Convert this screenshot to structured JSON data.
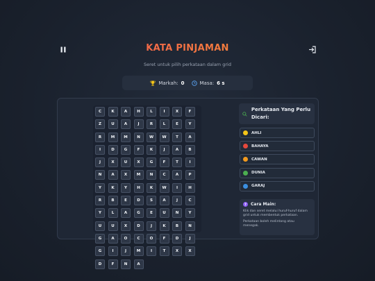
{
  "header": {
    "title": "KATA PINJAMAN",
    "subtitle": "Seret untuk pilih perkataan dalam grid",
    "pause_icon": "pause-icon",
    "exit_icon": "exit-icon"
  },
  "stats": {
    "score_label": "Markah:",
    "score_value": "0",
    "time_label": "Masa:",
    "time_value": "6 s"
  },
  "grid": [
    [
      "C",
      "K",
      "A",
      "H",
      "L",
      "I",
      "X",
      "F",
      "Z",
      "U"
    ],
    [
      "A",
      "J",
      "R",
      "L",
      "E",
      "Y",
      "R",
      "M",
      "M",
      "N"
    ],
    [
      "W",
      "W",
      "T",
      "A",
      "I",
      "D",
      "G",
      "F",
      "K",
      "J"
    ],
    [
      "A",
      "B",
      "J",
      "X",
      "U",
      "X",
      "G",
      "F",
      "T",
      "I"
    ],
    [
      "N",
      "A",
      "X",
      "M",
      "N",
      "C",
      "A",
      "P",
      "Y",
      "K"
    ],
    [
      "Y",
      "H",
      "K",
      "W",
      "I",
      "H",
      "R",
      "B",
      "E",
      "D"
    ],
    [
      "S",
      "A",
      "J",
      "C",
      "Y",
      "L",
      "A",
      "G",
      "E",
      "U"
    ],
    [
      "N",
      "Y",
      "U",
      "U",
      "X",
      "D",
      "J",
      "K",
      "B",
      "N"
    ],
    [
      "G",
      "A",
      "O",
      "C",
      "O",
      "F",
      "D",
      "J",
      "G",
      "I"
    ],
    [
      "J",
      "M",
      "I",
      "T",
      "X",
      "X",
      "D",
      "F",
      "N",
      "A"
    ]
  ],
  "words_panel": {
    "title": "Perkataan Yang Perlu Dicari:",
    "words": [
      {
        "label": "AHLI",
        "color": "#f5c518"
      },
      {
        "label": "BAHAYA",
        "color": "#e5483c"
      },
      {
        "label": "CAWAN",
        "color": "#f39a1e"
      },
      {
        "label": "DUNIA",
        "color": "#4caf50"
      },
      {
        "label": "GARAJ",
        "color": "#3b8fe0"
      }
    ]
  },
  "howto": {
    "title": "Cara Main:",
    "line1": "Klik dan seret melalui huruf-huruf dalam grid untuk membentuk perkataan.",
    "line2": "Perkataan boleh melintang atau menegak."
  },
  "colors": {
    "accent_start": "#f0475a",
    "accent_end": "#f59e2b"
  }
}
